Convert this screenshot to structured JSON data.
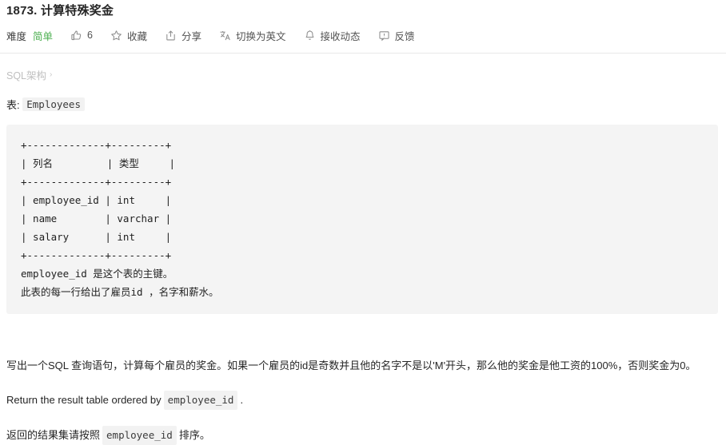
{
  "header": {
    "title": "1873. 计算特殊奖金",
    "toolbar": {
      "difficulty_label": "难度",
      "difficulty_value": "简单",
      "like_count": "6",
      "favorite_label": "收藏",
      "share_label": "分享",
      "translate_label": "切换为英文",
      "subscribe_label": "接收动态",
      "feedback_label": "反馈",
      "icons": {
        "like": "thumbs-up-icon",
        "favorite": "star-icon",
        "share": "share-icon",
        "translate": "translate-icon",
        "subscribe": "bell-icon",
        "feedback": "comment-icon"
      }
    },
    "accent_colors": {
      "difficulty_easy": "#4caf50",
      "text_primary": "#262626",
      "text_secondary": "#525252",
      "muted": "#bfbfbf",
      "code_bg": "#f4f4f4",
      "inline_code_bg": "#f2f2f2",
      "divider": "#e8e8e8"
    }
  },
  "breadcrumb": {
    "label": "SQL架构",
    "separator": "›"
  },
  "table_section": {
    "prefix": "表:",
    "table_name": "Employees",
    "code_block": "+-------------+---------+\n| 列名         | 类型     |\n+-------------+---------+\n| employee_id | int     |\n| name        | varchar |\n| salary      | int     |\n+-------------+---------+\nemployee_id 是这个表的主键。\n此表的每一行给出了雇员id ，名字和薪水。"
  },
  "description": {
    "main": "写出一个SQL 查询语句，计算每个雇员的奖金。如果一个雇员的id是奇数并且他的名字不是以'M'开头，那么他的奖金是他工资的100%，否则奖金为0。",
    "return_en_prefix": "Return the result table ordered by",
    "return_en_code": "employee_id",
    "return_en_suffix": ".",
    "return_cn_prefix": "返回的结果集请按照",
    "return_cn_code": "employee_id",
    "return_cn_suffix": "排序。"
  }
}
